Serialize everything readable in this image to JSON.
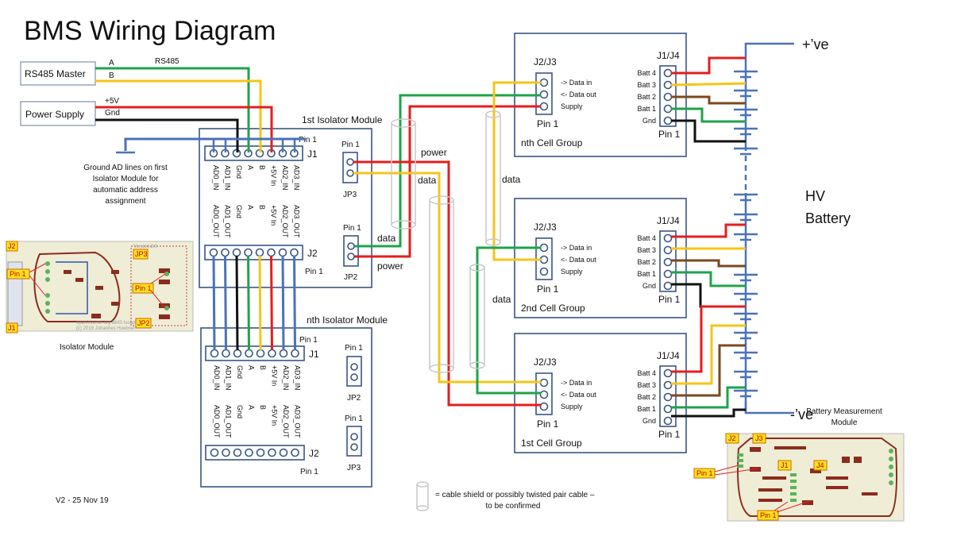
{
  "title": "BMS Wiring Diagram",
  "version_note": "V2 - 25 Nov 19",
  "colors": {
    "box_border": "#3a5585",
    "wire_red": "#e41e1e",
    "wire_yellow": "#f5c518",
    "wire_green": "#1fa34a",
    "wire_black": "#111111",
    "wire_blue": "#4a72b8",
    "wire_brown": "#7a4a1e",
    "shield": "#c8c8c8"
  },
  "sources": {
    "rs485_master": {
      "label": "RS485 Master",
      "wire_a": "A",
      "wire_b": "B",
      "bus_label": "RS485"
    },
    "power_supply": {
      "label": "Power Supply",
      "wire_pos": "+5V",
      "wire_gnd": "Gnd"
    }
  },
  "ground_note": [
    "Ground AD lines on first",
    "Isolator Module for",
    "automatic address",
    "assignment"
  ],
  "isolator_pins_in": [
    "AD0_IN",
    "AD1_IN",
    "Gnd",
    "A",
    "B",
    "+5V In",
    "AD2_IN",
    "AD3_IN"
  ],
  "isolator_pins_out": [
    "AD0_OUT",
    "AD1_OUT",
    "Gnd",
    "A",
    "B",
    "+5V In",
    "AD2_OUT",
    "AD3_OUT"
  ],
  "isolator_first": {
    "title": "1st Isolator Module",
    "j1": "J1",
    "j2": "J2",
    "pin1": "Pin 1",
    "jp3": "JP3",
    "jp2": "JP2"
  },
  "isolator_nth": {
    "title": "nth Isolator Module",
    "j1": "J1",
    "j2": "J2",
    "pin1": "Pin 1",
    "jp2": "JP2",
    "jp3": "JP3"
  },
  "wire_labels": {
    "power": "power",
    "data": "data"
  },
  "cell_group_conn": {
    "header": "J2/J3",
    "pins": [
      "-> Data in",
      "<- Data out",
      "Supply"
    ],
    "pin1": "Pin 1"
  },
  "cell_group_batt": {
    "header": "J1/J4",
    "pins": [
      "Batt 4",
      "Batt 3",
      "Batt 2",
      "Batt 1",
      "Gnd"
    ],
    "pin1": "Pin 1"
  },
  "cell_groups": [
    {
      "title": "nth Cell Group"
    },
    {
      "title": "2nd Cell Group"
    },
    {
      "title": "1st Cell Group"
    }
  ],
  "battery": {
    "pos": "+’ve",
    "neg": "-’ve",
    "label1": "HV",
    "label2": "Battery"
  },
  "isolator_pcb": {
    "caption": "Isolator Module",
    "tags": [
      "J2",
      "J1",
      "JP3",
      "JP2",
      "Pin 1",
      "Pin 1"
    ],
    "silkscreen": [
      "openinverter.org BMS Isolator",
      "(c) 2019 Johannes Huebner",
      "Version 2.0"
    ]
  },
  "measurement_pcb": {
    "caption1": "Battery Measurement",
    "caption2": "Module",
    "tags": [
      "J2",
      "J3",
      "J1",
      "J4",
      "Pin 1",
      "Pin 1"
    ]
  },
  "legend": {
    "line1": "= cable shield or possibly twisted pair cable –",
    "line2": "to be confirmed"
  }
}
